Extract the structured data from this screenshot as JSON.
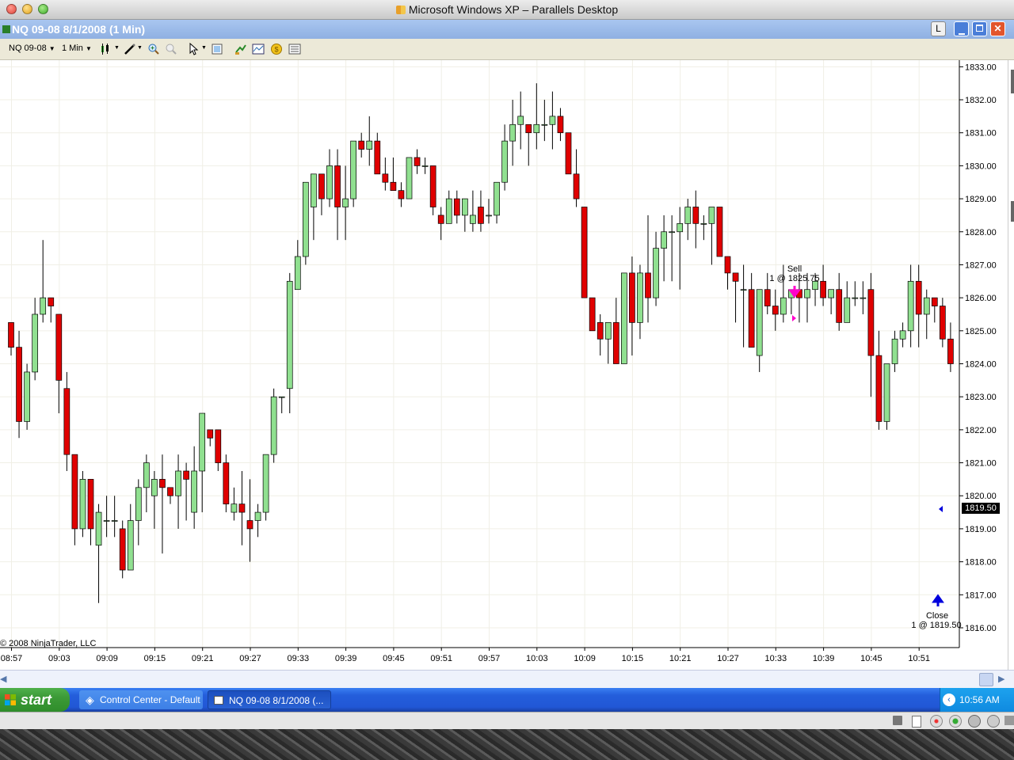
{
  "mac_window": {
    "title": "Microsoft Windows XP – Parallels Desktop"
  },
  "xp_window": {
    "title": "NQ 09-08  8/1/2008 (1 Min)",
    "buttons": {
      "l": "L"
    }
  },
  "toolbar": {
    "instrument": "NQ 09-08",
    "interval": "1 Min"
  },
  "chart_data": {
    "type": "candlestick",
    "y_ticks": [
      "1833.00",
      "1832.00",
      "1831.00",
      "1830.00",
      "1829.00",
      "1828.00",
      "1827.00",
      "1826.00",
      "1825.00",
      "1824.00",
      "1823.00",
      "1822.00",
      "1821.00",
      "1820.00",
      "1819.00",
      "1818.00",
      "1817.00",
      "1816.00"
    ],
    "ylim": [
      1815.4,
      1833.2
    ],
    "x_ticks": [
      "08:57",
      "09:03",
      "09:09",
      "09:15",
      "09:21",
      "09:27",
      "09:33",
      "09:39",
      "09:45",
      "09:51",
      "09:57",
      "10:03",
      "10:09",
      "10:15",
      "10:21",
      "10:27",
      "10:33",
      "10:39",
      "10:45",
      "10:51"
    ],
    "grid": true,
    "up_color": "#90e090",
    "down_color": "#e00000",
    "copyright": "© 2008 NinjaTrader, LLC",
    "last_price": "1819.50",
    "annotations": {
      "sell_label": "Sell",
      "sell_detail": "1 @ 1825.75",
      "close_label": "Close",
      "close_detail": "1 @ 1819.50"
    },
    "candles": [
      [
        1825.25,
        1825.25,
        1824.25,
        1824.5
      ],
      [
        1824.5,
        1825.0,
        1821.75,
        1822.25
      ],
      [
        1822.25,
        1824.0,
        1822.0,
        1823.75
      ],
      [
        1823.75,
        1826.0,
        1823.5,
        1825.5
      ],
      [
        1825.5,
        1827.75,
        1825.25,
        1826.0
      ],
      [
        1826.0,
        1826.0,
        1825.25,
        1825.75
      ],
      [
        1825.5,
        1825.5,
        1822.5,
        1823.5
      ],
      [
        1823.25,
        1823.75,
        1820.75,
        1821.25
      ],
      [
        1821.25,
        1821.25,
        1818.5,
        1819.0
      ],
      [
        1819.0,
        1820.75,
        1818.75,
        1820.5
      ],
      [
        1820.5,
        1820.5,
        1818.5,
        1819.0
      ],
      [
        1818.5,
        1819.75,
        1816.75,
        1819.5
      ],
      [
        1819.25,
        1820.0,
        1818.75,
        1819.25
      ],
      [
        1819.25,
        1820.0,
        1818.75,
        1819.25
      ],
      [
        1819.0,
        1819.25,
        1817.5,
        1817.75
      ],
      [
        1817.75,
        1819.75,
        1817.75,
        1819.25
      ],
      [
        1819.25,
        1820.5,
        1818.5,
        1820.25
      ],
      [
        1820.25,
        1821.25,
        1819.5,
        1821.0
      ],
      [
        1820.0,
        1820.75,
        1819.0,
        1820.5
      ],
      [
        1820.5,
        1821.25,
        1818.25,
        1820.25
      ],
      [
        1820.25,
        1820.25,
        1819.75,
        1820.0
      ],
      [
        1820.0,
        1821.25,
        1819.0,
        1820.75
      ],
      [
        1820.75,
        1821.0,
        1819.25,
        1820.5
      ],
      [
        1819.5,
        1821.5,
        1819.0,
        1820.75
      ],
      [
        1820.75,
        1822.25,
        1819.5,
        1822.5
      ],
      [
        1822.0,
        1822.0,
        1821.5,
        1821.75
      ],
      [
        1822.0,
        1822.0,
        1820.75,
        1821.0
      ],
      [
        1821.0,
        1821.25,
        1819.5,
        1819.75
      ],
      [
        1819.5,
        1820.25,
        1819.25,
        1819.75
      ],
      [
        1819.75,
        1820.75,
        1818.5,
        1819.5
      ],
      [
        1819.25,
        1820.5,
        1818.0,
        1819.0
      ],
      [
        1819.25,
        1819.75,
        1818.75,
        1819.5
      ],
      [
        1819.5,
        1821.25,
        1819.25,
        1821.25
      ],
      [
        1821.25,
        1823.25,
        1821.0,
        1823.0
      ],
      [
        1823.0,
        1823.0,
        1822.5,
        1823.0
      ],
      [
        1823.25,
        1826.75,
        1822.5,
        1826.5
      ],
      [
        1826.25,
        1827.75,
        1826.25,
        1827.25
      ],
      [
        1827.25,
        1829.5,
        1827.0,
        1829.5
      ],
      [
        1828.75,
        1829.75,
        1827.75,
        1829.75
      ],
      [
        1829.75,
        1829.75,
        1828.5,
        1829.0
      ],
      [
        1829.0,
        1830.5,
        1828.75,
        1830.0
      ],
      [
        1830.0,
        1830.5,
        1827.75,
        1828.75
      ],
      [
        1828.75,
        1830.0,
        1827.75,
        1829.0
      ],
      [
        1829.0,
        1830.75,
        1828.75,
        1830.75
      ],
      [
        1830.75,
        1831.0,
        1830.25,
        1830.5
      ],
      [
        1830.5,
        1831.5,
        1830.0,
        1830.75
      ],
      [
        1830.75,
        1831.0,
        1829.75,
        1829.75
      ],
      [
        1829.75,
        1830.25,
        1829.25,
        1829.5
      ],
      [
        1829.5,
        1830.25,
        1829.5,
        1829.25
      ],
      [
        1829.25,
        1829.5,
        1828.75,
        1829.0
      ],
      [
        1829.0,
        1830.25,
        1829.0,
        1830.25
      ],
      [
        1830.25,
        1830.5,
        1829.75,
        1830.0
      ],
      [
        1830.0,
        1830.25,
        1829.75,
        1830.0
      ],
      [
        1830.0,
        1830.0,
        1828.5,
        1828.75
      ],
      [
        1828.5,
        1828.75,
        1827.75,
        1828.25
      ],
      [
        1828.25,
        1829.25,
        1828.25,
        1829.0
      ],
      [
        1829.0,
        1829.25,
        1828.25,
        1828.5
      ],
      [
        1828.5,
        1829.0,
        1828.0,
        1829.0
      ],
      [
        1828.25,
        1829.25,
        1828.0,
        1828.5
      ],
      [
        1828.75,
        1829.25,
        1828.0,
        1828.25
      ],
      [
        1828.5,
        1829.0,
        1828.25,
        1828.5
      ],
      [
        1828.5,
        1829.5,
        1828.25,
        1829.5
      ],
      [
        1829.5,
        1831.25,
        1829.25,
        1830.75
      ],
      [
        1830.75,
        1832.0,
        1830.0,
        1831.25
      ],
      [
        1831.25,
        1832.25,
        1830.5,
        1831.5
      ],
      [
        1831.25,
        1831.25,
        1830.0,
        1831.0
      ],
      [
        1831.0,
        1832.5,
        1830.5,
        1831.25
      ],
      [
        1831.25,
        1832.0,
        1830.75,
        1831.25
      ],
      [
        1831.25,
        1832.25,
        1830.5,
        1831.5
      ],
      [
        1831.5,
        1831.75,
        1830.75,
        1831.0
      ],
      [
        1831.0,
        1831.0,
        1829.75,
        1829.75
      ],
      [
        1829.75,
        1830.5,
        1828.75,
        1829.0
      ],
      [
        1828.75,
        1828.75,
        1826.0,
        1826.0
      ],
      [
        1826.0,
        1826.0,
        1825.0,
        1825.0
      ],
      [
        1825.25,
        1825.5,
        1824.25,
        1824.75
      ],
      [
        1824.75,
        1825.25,
        1824.0,
        1825.25
      ],
      [
        1825.25,
        1826.0,
        1824.0,
        1824.0
      ],
      [
        1824.0,
        1826.75,
        1824.0,
        1826.75
      ],
      [
        1826.75,
        1827.25,
        1824.25,
        1825.25
      ],
      [
        1825.25,
        1827.0,
        1824.75,
        1826.75
      ],
      [
        1826.75,
        1828.5,
        1825.25,
        1826.0
      ],
      [
        1826.0,
        1828.0,
        1825.75,
        1827.5
      ],
      [
        1827.5,
        1828.5,
        1826.5,
        1828.0
      ],
      [
        1828.0,
        1828.5,
        1826.5,
        1828.0
      ],
      [
        1828.0,
        1828.75,
        1826.25,
        1828.25
      ],
      [
        1828.25,
        1829.0,
        1827.75,
        1828.75
      ],
      [
        1828.75,
        1829.25,
        1827.5,
        1828.25
      ],
      [
        1828.25,
        1828.5,
        1827.75,
        1828.25
      ],
      [
        1828.25,
        1828.75,
        1827.0,
        1828.75
      ],
      [
        1828.75,
        1828.75,
        1827.25,
        1827.25
      ],
      [
        1827.25,
        1827.25,
        1826.25,
        1826.75
      ],
      [
        1826.75,
        1826.75,
        1825.25,
        1826.5
      ],
      [
        1826.25,
        1827.0,
        1824.5,
        1826.25
      ],
      [
        1826.25,
        1826.75,
        1824.5,
        1824.5
      ],
      [
        1824.25,
        1826.25,
        1823.75,
        1826.25
      ],
      [
        1826.25,
        1826.75,
        1825.5,
        1825.75
      ],
      [
        1825.75,
        1826.25,
        1825.0,
        1825.5
      ],
      [
        1825.5,
        1827.0,
        1825.25,
        1826.0
      ],
      [
        1826.0,
        1826.25,
        1825.5,
        1826.25
      ],
      [
        1826.25,
        1826.75,
        1825.25,
        1826.0
      ],
      [
        1826.0,
        1826.75,
        1825.25,
        1826.25
      ],
      [
        1826.25,
        1826.75,
        1825.75,
        1826.5
      ],
      [
        1826.5,
        1827.0,
        1825.75,
        1826.0
      ],
      [
        1826.0,
        1826.25,
        1825.5,
        1826.25
      ],
      [
        1826.25,
        1826.75,
        1825.0,
        1825.25
      ],
      [
        1825.25,
        1826.5,
        1825.25,
        1826.0
      ],
      [
        1826.0,
        1826.5,
        1825.75,
        1826.0
      ],
      [
        1826.0,
        1826.5,
        1825.5,
        1826.0
      ],
      [
        1826.25,
        1826.75,
        1823.0,
        1824.25
      ],
      [
        1824.25,
        1825.0,
        1822.0,
        1822.25
      ],
      [
        1822.25,
        1824.0,
        1822.0,
        1824.0
      ],
      [
        1824.0,
        1825.0,
        1823.75,
        1824.75
      ],
      [
        1824.75,
        1825.25,
        1824.5,
        1825.0
      ],
      [
        1825.0,
        1827.0,
        1824.5,
        1826.5
      ],
      [
        1826.5,
        1827.0,
        1824.5,
        1825.5
      ],
      [
        1825.5,
        1826.25,
        1824.75,
        1826.0
      ],
      [
        1826.0,
        1826.0,
        1825.25,
        1825.75
      ],
      [
        1825.75,
        1826.0,
        1824.5,
        1824.75
      ],
      [
        1824.75,
        1825.25,
        1823.75,
        1824.0
      ],
      [
        1824.0,
        1825.0,
        1822.75,
        1823.25
      ],
      [
        1823.25,
        1825.0,
        1822.5,
        1823.5
      ],
      [
        1823.75,
        1824.25,
        1822.25,
        1822.25
      ],
      [
        1822.25,
        1823.5,
        1821.75,
        1822.5
      ],
      [
        1822.5,
        1823.5,
        1822.5,
        1822.5
      ],
      [
        1822.5,
        1823.5,
        1822.25,
        1823.25
      ],
      [
        1823.25,
        1823.75,
        1822.5,
        1823.5
      ],
      [
        1823.5,
        1823.75,
        1823.0,
        1823.0
      ],
      [
        1822.75,
        1823.0,
        1822.25,
        1822.5
      ],
      [
        1822.5,
        1822.5,
        1821.5,
        1822.0
      ],
      [
        1822.0,
        1822.5,
        1821.75,
        1822.5
      ],
      [
        1822.5,
        1823.0,
        1822.0,
        1822.0
      ],
      [
        1821.75,
        1821.75,
        1819.0,
        1819.5
      ],
      [
        1819.25,
        1819.25,
        1817.0,
        1817.75
      ],
      [
        1817.5,
        1820.0,
        1817.0,
        1819.75
      ],
      [
        1819.5,
        1819.75,
        1819.25,
        1819.5
      ]
    ]
  },
  "taskbar": {
    "start_label": "start",
    "items": [
      {
        "label": "Control Center - Default"
      },
      {
        "label": "NQ 09-08  8/1/2008 (..."
      }
    ],
    "clock": "10:56 AM"
  }
}
